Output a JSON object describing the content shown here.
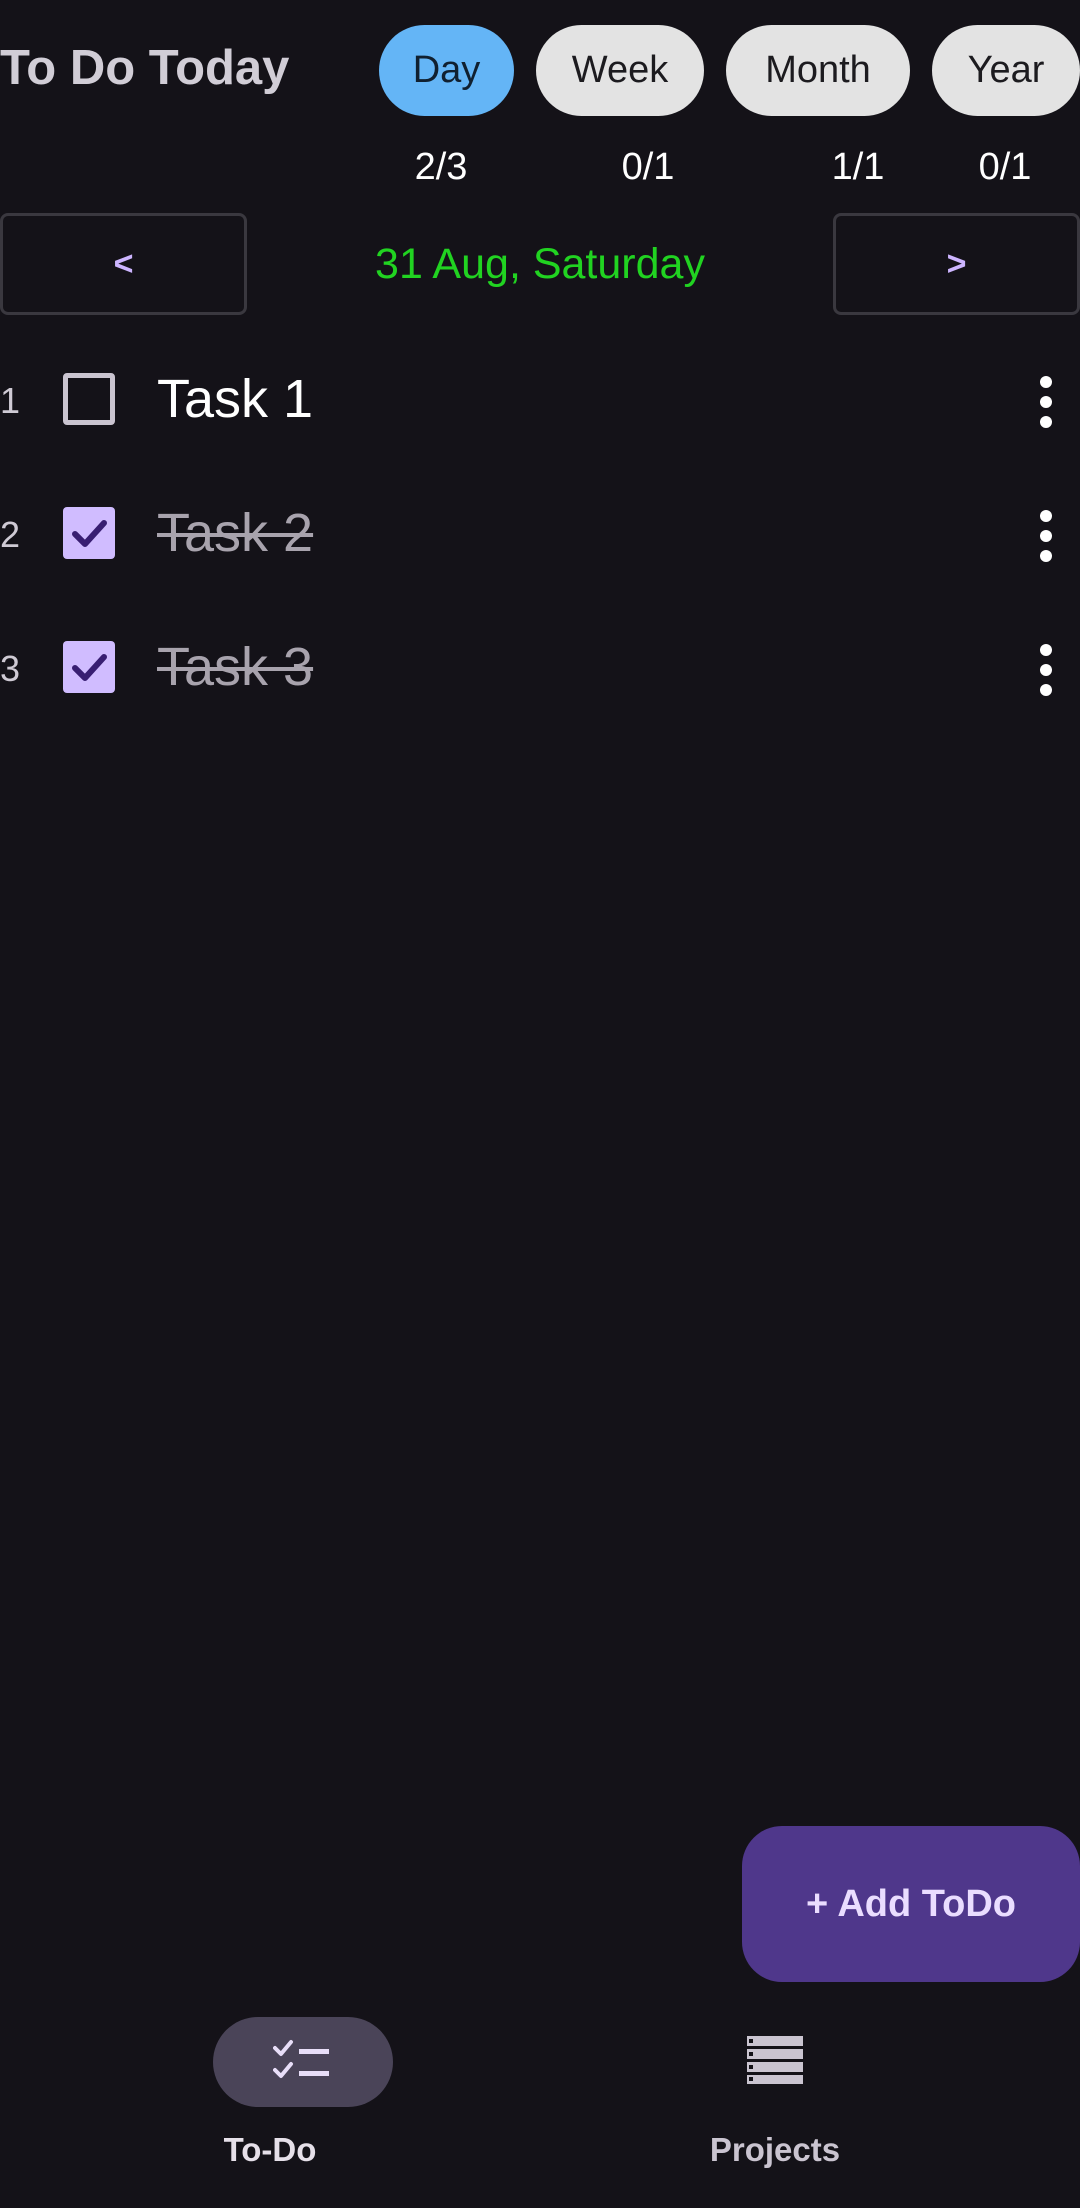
{
  "header": {
    "title": "To Do Today",
    "periods": [
      {
        "label": "Day",
        "count": "2/3",
        "active": true
      },
      {
        "label": "Week",
        "count": "0/1",
        "active": false
      },
      {
        "label": "Month",
        "count": "1/1",
        "active": false
      },
      {
        "label": "Year",
        "count": "0/1",
        "active": false
      }
    ]
  },
  "date_nav": {
    "prev_label": "<",
    "next_label": ">",
    "date": "31 Aug, Saturday",
    "date_color": "#21d321"
  },
  "tasks": [
    {
      "number": "1",
      "title": "Task 1",
      "done": false
    },
    {
      "number": "2",
      "title": "Task 2",
      "done": true
    },
    {
      "number": "3",
      "title": "Task 3",
      "done": true
    }
  ],
  "fab": {
    "label": "+ Add ToDo"
  },
  "bottom_nav": {
    "items": [
      {
        "label": "To-Do",
        "icon": "checklist-icon",
        "selected": true
      },
      {
        "label": "Projects",
        "icon": "list-stack-icon",
        "selected": false
      }
    ]
  },
  "colors": {
    "background": "#141218",
    "active_chip": "#64b5f6",
    "checkbox_checked": "#d0bcff",
    "fab": "#4f378b"
  }
}
